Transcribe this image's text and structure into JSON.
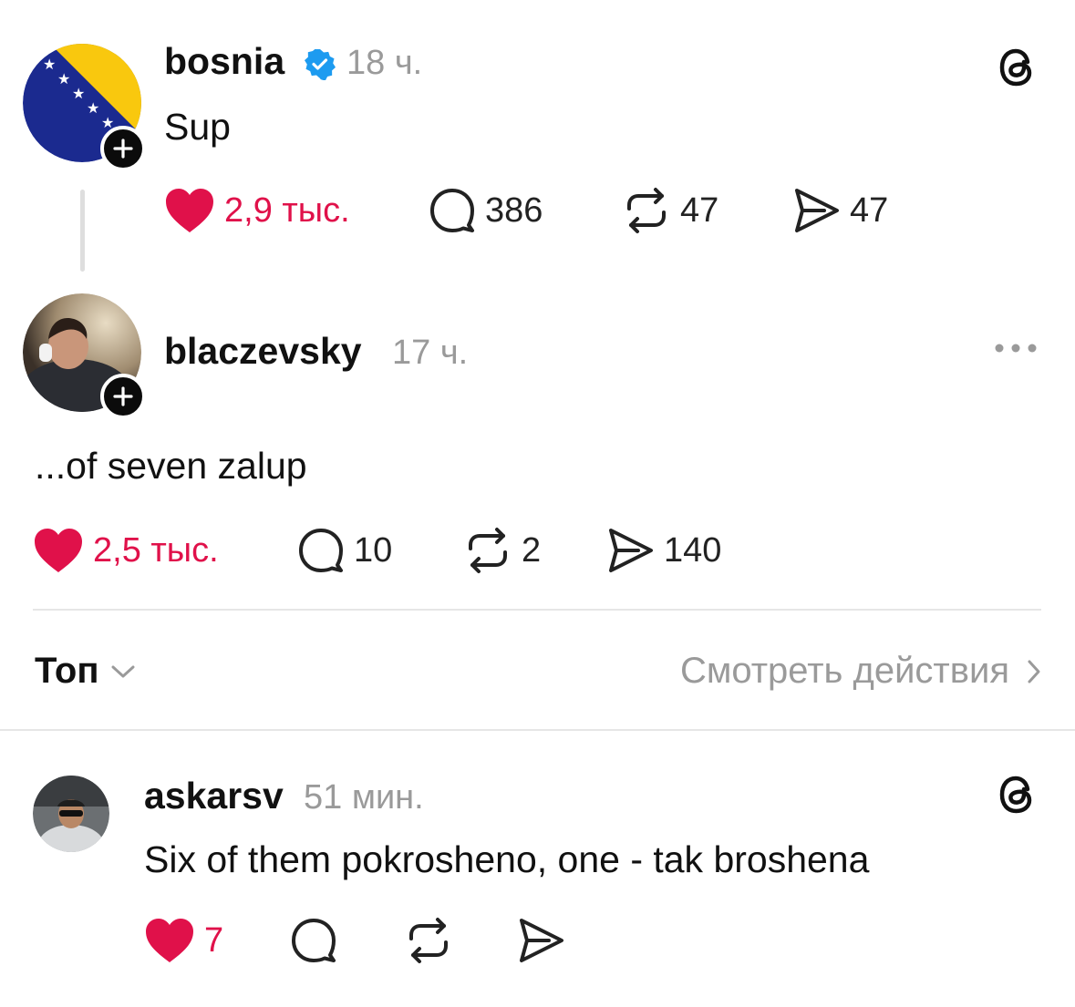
{
  "posts": [
    {
      "username": "bosnia",
      "time": "18 ч.",
      "text": "Sup",
      "likes": "2,9 тыс.",
      "comments": "386",
      "reposts": "47",
      "shares": "47",
      "verified": true,
      "menu_icon": "threads-logo-icon"
    },
    {
      "username": "blaczevsky",
      "time": "17 ч.",
      "text": "...of seven zalup",
      "likes": "2,5 тыс.",
      "comments": "10",
      "reposts": "2",
      "shares": "140",
      "menu_icon": "more-dots-icon"
    }
  ],
  "sort_bar": {
    "sort_label": "Топ",
    "activity_link": "Смотреть действия"
  },
  "reply": {
    "username": "askarsv",
    "time": "51 мин.",
    "text": "Six of them pokrosheno, one - tak broshena",
    "likes": "7",
    "menu_icon": "threads-logo-icon"
  },
  "colors": {
    "like_red": "#e0114a",
    "verified_blue": "#1d9bf0",
    "muted_gray": "#9a9a9a",
    "flag_blue": "#1b2a8f",
    "flag_yellow": "#f9c80e"
  }
}
